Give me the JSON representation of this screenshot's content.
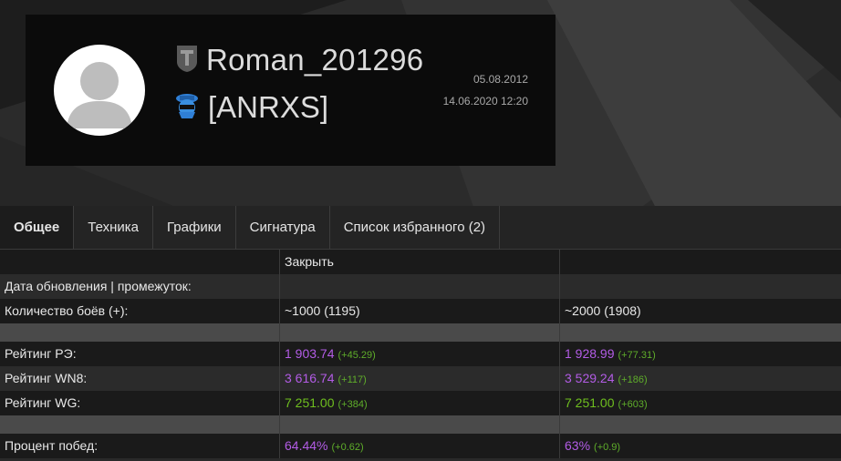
{
  "profile": {
    "nickname": "Roman_201296",
    "clan": "[ANRXS]",
    "registered": "05.08.2012",
    "last_battle": "14.06.2020 12:20"
  },
  "tabs": [
    {
      "label": "Общее"
    },
    {
      "label": "Техника"
    },
    {
      "label": "Графики"
    },
    {
      "label": "Сигнатура"
    },
    {
      "label": "Список избранного (2)"
    }
  ],
  "table": {
    "close_label": "Закрыть",
    "rows": {
      "update_label": "Дата обновления | промежуток:",
      "battles": {
        "label": "Количество боёв (+):",
        "v1": "~1000 (1195)",
        "v2": "~2000 (1908)"
      },
      "re": {
        "label": "Рейтинг РЭ:",
        "v1": "1 903.74",
        "d1": "(+45.29)",
        "v2": "1 928.99",
        "d2": "(+77.31)"
      },
      "wn8": {
        "label": "Рейтинг WN8:",
        "v1": "3 616.74",
        "d1": "(+117)",
        "v2": "3 529.24",
        "d2": "(+186)"
      },
      "wg": {
        "label": "Рейтинг WG:",
        "v1": "7 251.00",
        "d1": "(+384)",
        "v2": "7 251.00",
        "d2": "(+603)"
      },
      "winrate": {
        "label": "Процент побед:",
        "v1": "64.44%",
        "d1": "(+0.62)",
        "v2": "63%",
        "d2": "(+0.9)"
      }
    }
  },
  "colors": {
    "purple": "#b35ce6",
    "green": "#6fbf1f"
  }
}
